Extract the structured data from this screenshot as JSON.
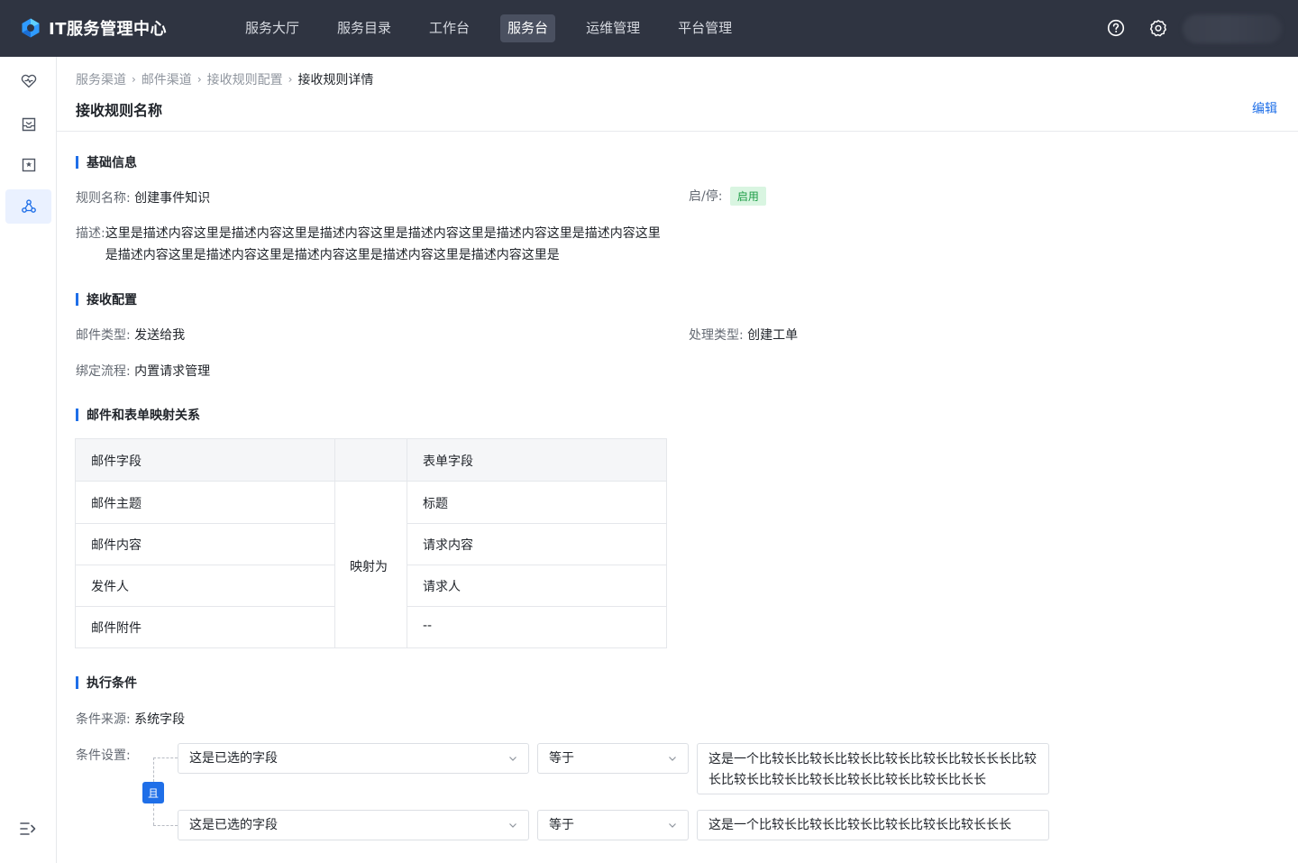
{
  "app": {
    "title": "IT服务管理中心"
  },
  "nav": {
    "items": [
      {
        "label": "服务大厅",
        "active": false
      },
      {
        "label": "服务目录",
        "active": false
      },
      {
        "label": "工作台",
        "active": false
      },
      {
        "label": "服务台",
        "active": true
      },
      {
        "label": "运维管理",
        "active": false
      },
      {
        "label": "平台管理",
        "active": false
      }
    ],
    "icons": [
      "help-circle-icon",
      "gear-icon"
    ]
  },
  "sidebar": {
    "items": [
      {
        "icon": "heart-pulse-icon",
        "active": false
      },
      {
        "icon": "inbox-icon",
        "active": false
      },
      {
        "icon": "star-board-icon",
        "active": false
      },
      {
        "icon": "cluster-icon",
        "active": true
      }
    ],
    "collapse_icon": "collapse-menu-icon"
  },
  "breadcrumb": [
    "服务渠道",
    "邮件渠道",
    "接收规则配置",
    "接收规则详情"
  ],
  "page": {
    "title": "接收规则名称",
    "edit_label": "编辑"
  },
  "basic": {
    "section_title": "基础信息",
    "rule_name_label": "规则名称:",
    "rule_name_value": "创建事件知识",
    "status_label": "启/停:",
    "status_value": "启用",
    "desc_label": "描述:",
    "desc_value": "这里是描述内容这里是描述内容这里是描述内容这里是描述内容这里是描述内容这里是描述内容这里是描述内容这里是描述内容这里是描述内容这里是描述内容这里是描述内容这里是"
  },
  "receive": {
    "section_title": "接收配置",
    "mail_type_label": "邮件类型:",
    "mail_type_value": "发送给我",
    "process_type_label": "处理类型:",
    "process_type_value": "创建工单",
    "flow_label": "绑定流程:",
    "flow_value": "内置请求管理"
  },
  "mapping": {
    "section_title": "邮件和表单映射关系",
    "header_mail": "邮件字段",
    "header_form": "表单字段",
    "map_label": "映射为",
    "rows": [
      {
        "mail": "邮件主题",
        "form": "标题"
      },
      {
        "mail": "邮件内容",
        "form": "请求内容"
      },
      {
        "mail": "发件人",
        "form": "请求人"
      },
      {
        "mail": "邮件附件",
        "form": "--"
      }
    ]
  },
  "conditions": {
    "section_title": "执行条件",
    "source_label": "条件来源:",
    "source_value": "系统字段",
    "setting_label": "条件设置:",
    "logic": "且",
    "rows": [
      {
        "field": "这是已选的字段",
        "operator": "等于",
        "value": "这是一个比较长比较长比较长比较长比较长比较长长长比较长比较长比较长比较长比较长比较长比较长比长长"
      },
      {
        "field": "这是已选的字段",
        "operator": "等于",
        "value": "这是一个比较长比较长比较长比较长比较长比较长长长"
      }
    ]
  },
  "colors": {
    "topbar": "#2f3441",
    "accent": "#1f6fe8",
    "status_on_bg": "#d9f5e1",
    "status_on_text": "#1a9b44"
  }
}
